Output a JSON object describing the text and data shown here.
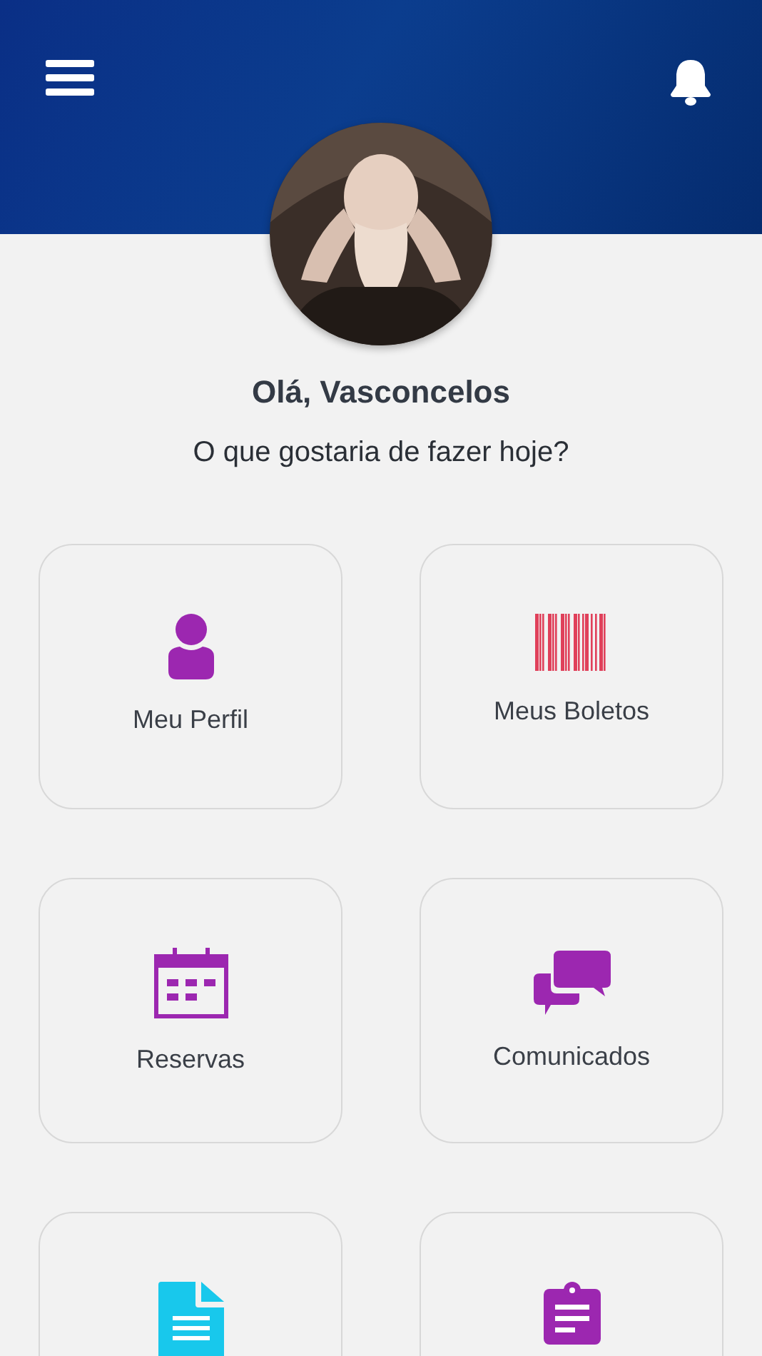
{
  "greeting": "Olá, Vasconcelos",
  "subtitle": "O que gostaria de fazer hoje?",
  "tiles": [
    {
      "label": "Meu Perfil",
      "color": "#9c27b0"
    },
    {
      "label": "Meus Boletos",
      "color": "#e0405a"
    },
    {
      "label": "Reservas",
      "color": "#9c27b0"
    },
    {
      "label": "Comunicados",
      "color": "#9c27b0"
    },
    {
      "color": "#18c8ec"
    },
    {
      "color": "#9c27b0"
    }
  ]
}
